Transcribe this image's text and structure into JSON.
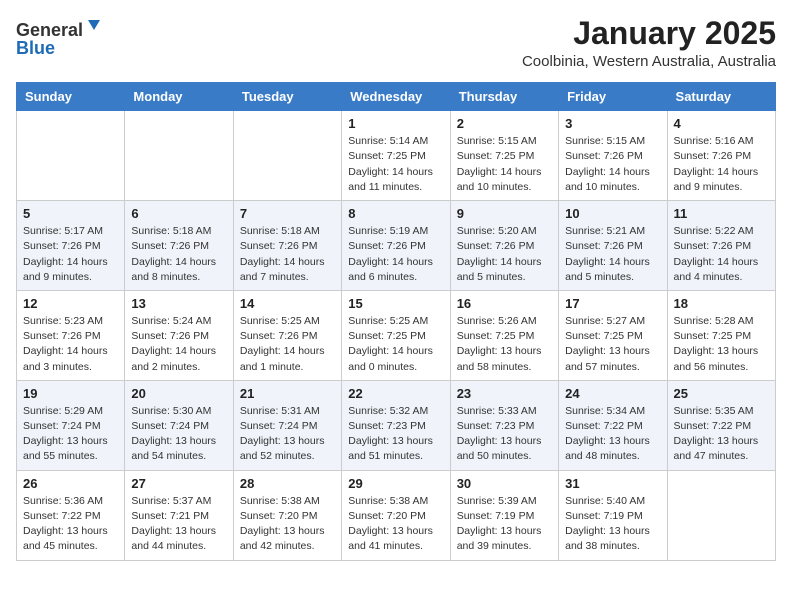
{
  "header": {
    "logo_general": "General",
    "logo_blue": "Blue",
    "month": "January 2025",
    "location": "Coolbinia, Western Australia, Australia"
  },
  "weekdays": [
    "Sunday",
    "Monday",
    "Tuesday",
    "Wednesday",
    "Thursday",
    "Friday",
    "Saturday"
  ],
  "weeks": [
    [
      {
        "day": "",
        "info": ""
      },
      {
        "day": "",
        "info": ""
      },
      {
        "day": "",
        "info": ""
      },
      {
        "day": "1",
        "info": "Sunrise: 5:14 AM\nSunset: 7:25 PM\nDaylight: 14 hours and 11 minutes."
      },
      {
        "day": "2",
        "info": "Sunrise: 5:15 AM\nSunset: 7:25 PM\nDaylight: 14 hours and 10 minutes."
      },
      {
        "day": "3",
        "info": "Sunrise: 5:15 AM\nSunset: 7:26 PM\nDaylight: 14 hours and 10 minutes."
      },
      {
        "day": "4",
        "info": "Sunrise: 5:16 AM\nSunset: 7:26 PM\nDaylight: 14 hours and 9 minutes."
      }
    ],
    [
      {
        "day": "5",
        "info": "Sunrise: 5:17 AM\nSunset: 7:26 PM\nDaylight: 14 hours and 9 minutes."
      },
      {
        "day": "6",
        "info": "Sunrise: 5:18 AM\nSunset: 7:26 PM\nDaylight: 14 hours and 8 minutes."
      },
      {
        "day": "7",
        "info": "Sunrise: 5:18 AM\nSunset: 7:26 PM\nDaylight: 14 hours and 7 minutes."
      },
      {
        "day": "8",
        "info": "Sunrise: 5:19 AM\nSunset: 7:26 PM\nDaylight: 14 hours and 6 minutes."
      },
      {
        "day": "9",
        "info": "Sunrise: 5:20 AM\nSunset: 7:26 PM\nDaylight: 14 hours and 5 minutes."
      },
      {
        "day": "10",
        "info": "Sunrise: 5:21 AM\nSunset: 7:26 PM\nDaylight: 14 hours and 5 minutes."
      },
      {
        "day": "11",
        "info": "Sunrise: 5:22 AM\nSunset: 7:26 PM\nDaylight: 14 hours and 4 minutes."
      }
    ],
    [
      {
        "day": "12",
        "info": "Sunrise: 5:23 AM\nSunset: 7:26 PM\nDaylight: 14 hours and 3 minutes."
      },
      {
        "day": "13",
        "info": "Sunrise: 5:24 AM\nSunset: 7:26 PM\nDaylight: 14 hours and 2 minutes."
      },
      {
        "day": "14",
        "info": "Sunrise: 5:25 AM\nSunset: 7:26 PM\nDaylight: 14 hours and 1 minute."
      },
      {
        "day": "15",
        "info": "Sunrise: 5:25 AM\nSunset: 7:25 PM\nDaylight: 14 hours and 0 minutes."
      },
      {
        "day": "16",
        "info": "Sunrise: 5:26 AM\nSunset: 7:25 PM\nDaylight: 13 hours and 58 minutes."
      },
      {
        "day": "17",
        "info": "Sunrise: 5:27 AM\nSunset: 7:25 PM\nDaylight: 13 hours and 57 minutes."
      },
      {
        "day": "18",
        "info": "Sunrise: 5:28 AM\nSunset: 7:25 PM\nDaylight: 13 hours and 56 minutes."
      }
    ],
    [
      {
        "day": "19",
        "info": "Sunrise: 5:29 AM\nSunset: 7:24 PM\nDaylight: 13 hours and 55 minutes."
      },
      {
        "day": "20",
        "info": "Sunrise: 5:30 AM\nSunset: 7:24 PM\nDaylight: 13 hours and 54 minutes."
      },
      {
        "day": "21",
        "info": "Sunrise: 5:31 AM\nSunset: 7:24 PM\nDaylight: 13 hours and 52 minutes."
      },
      {
        "day": "22",
        "info": "Sunrise: 5:32 AM\nSunset: 7:23 PM\nDaylight: 13 hours and 51 minutes."
      },
      {
        "day": "23",
        "info": "Sunrise: 5:33 AM\nSunset: 7:23 PM\nDaylight: 13 hours and 50 minutes."
      },
      {
        "day": "24",
        "info": "Sunrise: 5:34 AM\nSunset: 7:22 PM\nDaylight: 13 hours and 48 minutes."
      },
      {
        "day": "25",
        "info": "Sunrise: 5:35 AM\nSunset: 7:22 PM\nDaylight: 13 hours and 47 minutes."
      }
    ],
    [
      {
        "day": "26",
        "info": "Sunrise: 5:36 AM\nSunset: 7:22 PM\nDaylight: 13 hours and 45 minutes."
      },
      {
        "day": "27",
        "info": "Sunrise: 5:37 AM\nSunset: 7:21 PM\nDaylight: 13 hours and 44 minutes."
      },
      {
        "day": "28",
        "info": "Sunrise: 5:38 AM\nSunset: 7:20 PM\nDaylight: 13 hours and 42 minutes."
      },
      {
        "day": "29",
        "info": "Sunrise: 5:38 AM\nSunset: 7:20 PM\nDaylight: 13 hours and 41 minutes."
      },
      {
        "day": "30",
        "info": "Sunrise: 5:39 AM\nSunset: 7:19 PM\nDaylight: 13 hours and 39 minutes."
      },
      {
        "day": "31",
        "info": "Sunrise: 5:40 AM\nSunset: 7:19 PM\nDaylight: 13 hours and 38 minutes."
      },
      {
        "day": "",
        "info": ""
      }
    ]
  ]
}
